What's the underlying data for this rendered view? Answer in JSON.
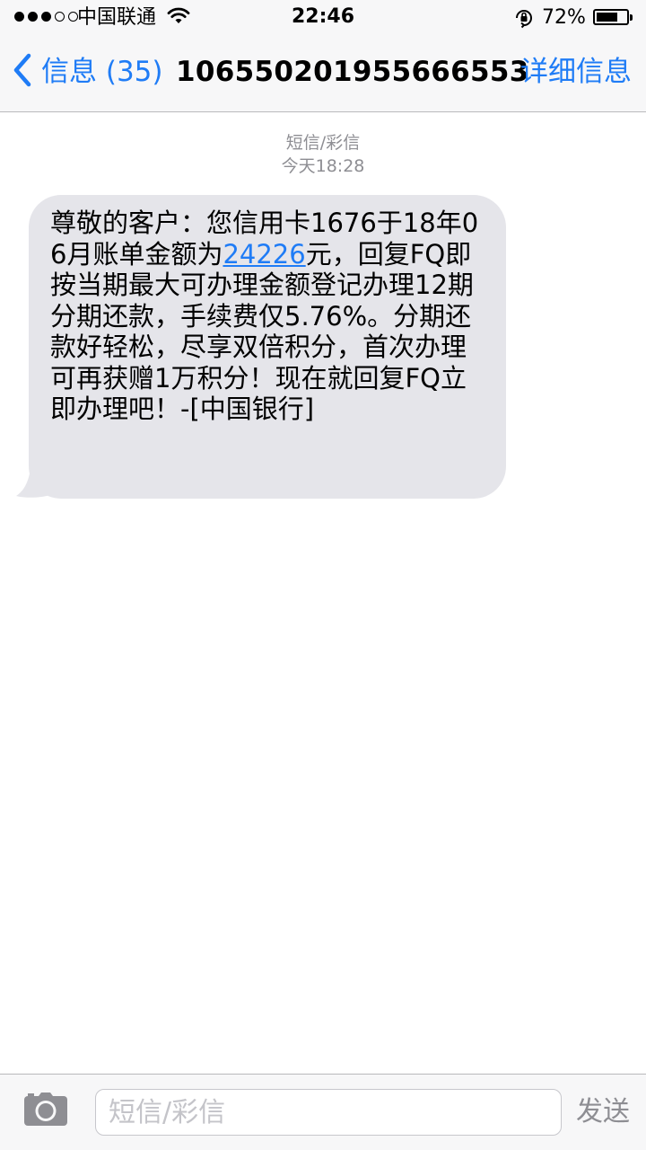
{
  "status_bar": {
    "carrier": "中国联通",
    "time": "22:46",
    "battery_percent_label": "72%",
    "battery_level": 0.72,
    "signal_bars_filled": 3,
    "signal_bars_total": 5
  },
  "nav": {
    "back_label": "信息 (35)",
    "title": "10655020195566655​3",
    "details_label": "详细信息"
  },
  "thread": {
    "message_type": "短信/彩信",
    "timestamp": "今天18:28",
    "message": {
      "before_link": "尊敬的客户：您信用卡1676于18年06月账单金额为",
      "link_text": "24226",
      "after_link": "元，回复FQ即按当期最大可办理金额登记办理12期分期还款，手续费仅5.76%。分期还款好轻松，尽享双倍积分，首次办理可再获赠1万积分！现在就回复FQ立即办理吧！-[中国银行]"
    }
  },
  "composer": {
    "placeholder": "短信/彩信",
    "value": "",
    "send_label": "发送"
  },
  "colors": {
    "accent": "#1f7cf6",
    "bubble": "#e5e5ea",
    "muted": "#8e8e93"
  },
  "icons": [
    "back-chevron-icon",
    "wifi-icon",
    "rotation-lock-icon",
    "battery-icon",
    "camera-icon"
  ]
}
